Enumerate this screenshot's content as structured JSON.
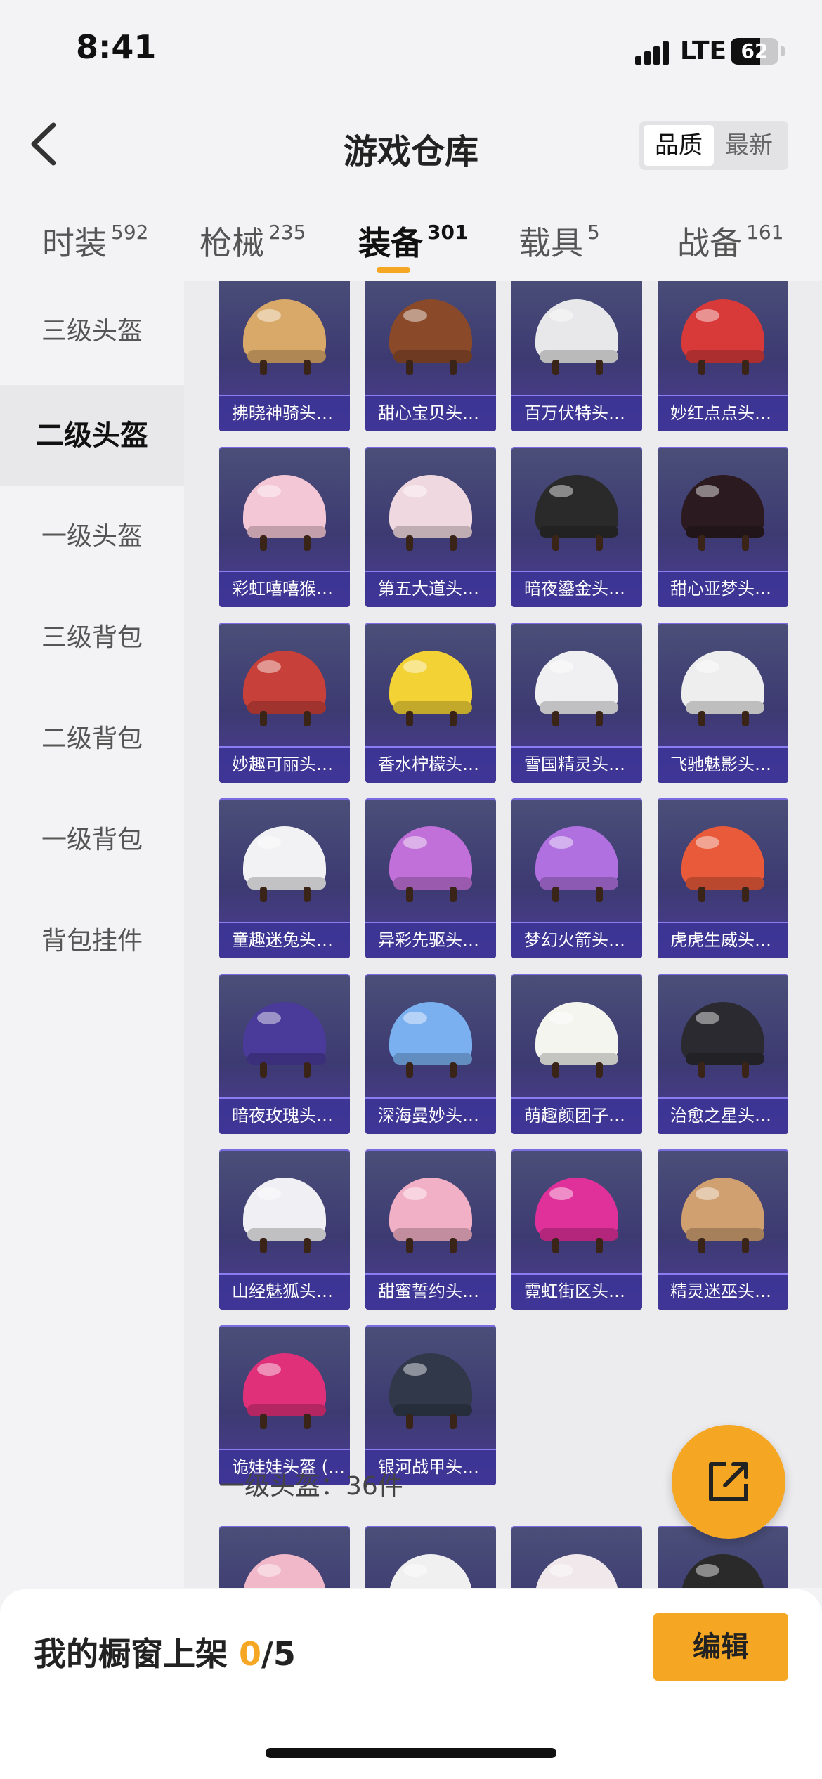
{
  "status": {
    "time": "8:41",
    "network": "LTE",
    "battery": "62",
    "battery_level": 0.62
  },
  "header": {
    "title": "游戏仓库",
    "sort_options": [
      "品质",
      "最新"
    ],
    "active_sort": "品质"
  },
  "tabs": [
    {
      "label": "时装",
      "count": "592"
    },
    {
      "label": "枪械",
      "count": "235"
    },
    {
      "label": "装备",
      "count": "301"
    },
    {
      "label": "载具",
      "count": "5"
    },
    {
      "label": "战备",
      "count": "161"
    }
  ],
  "sidebar": {
    "items": [
      "三级头盔",
      "二级头盔",
      "一级头盔",
      "三级背包",
      "二级背包",
      "一级背包",
      "背包挂件"
    ],
    "active": "二级头盔"
  },
  "items": [
    {
      "name": "拂晓神骑头…",
      "color": "#d9a96a"
    },
    {
      "name": "甜心宝贝头…",
      "color": "#8a4a2a"
    },
    {
      "name": "百万伏特头…",
      "color": "#e8e8ea"
    },
    {
      "name": "妙红点点头…",
      "color": "#d83a3a"
    },
    {
      "name": "彩虹嘻嘻猴…",
      "color": "#f4c7d6"
    },
    {
      "name": "第五大道头…",
      "color": "#f0d8e0"
    },
    {
      "name": "暗夜鎏金头…",
      "color": "#2a2a2a"
    },
    {
      "name": "甜心亚梦头…",
      "color": "#2b1a20"
    },
    {
      "name": "妙趣可丽头…",
      "color": "#c8403a"
    },
    {
      "name": "香水柠檬头…",
      "color": "#f3d236"
    },
    {
      "name": "雪国精灵头…",
      "color": "#f0f0f2"
    },
    {
      "name": "飞驰魅影头…",
      "color": "#eeeeee"
    },
    {
      "name": "童趣迷兔头…",
      "color": "#f2f2f5"
    },
    {
      "name": "异彩先驱头…",
      "color": "#c070d8"
    },
    {
      "name": "梦幻火箭头…",
      "color": "#b070e0"
    },
    {
      "name": "虎虎生威头…",
      "color": "#e85a3a"
    },
    {
      "name": "暗夜玫瑰头…",
      "color": "#4a3a9a"
    },
    {
      "name": "深海曼妙头…",
      "color": "#7ab0f0"
    },
    {
      "name": "萌趣颜团子…",
      "color": "#f5f5f0"
    },
    {
      "name": "治愈之星头…",
      "color": "#2a2a30"
    },
    {
      "name": "山经魅狐头…",
      "color": "#f0f0f4"
    },
    {
      "name": "甜蜜誓约头…",
      "color": "#f2b0c6"
    },
    {
      "name": "霓虹街区头…",
      "color": "#e0309a"
    },
    {
      "name": "精灵迷巫头…",
      "color": "#d0a070"
    },
    {
      "name": "诡娃娃头盔 (…",
      "color": "#e0307a"
    },
    {
      "name": "银河战甲头…",
      "color": "#30384a"
    }
  ],
  "section": {
    "label": "一级头盔：36件"
  },
  "next_items_colors": [
    "#f0b8c8",
    "#f0f0f0",
    "#f0e8ea",
    "#2a2a2a"
  ],
  "bottom": {
    "shelf_label": "我的橱窗上架",
    "shelf_count": "0",
    "shelf_total": "/5",
    "edit_label": "编辑"
  }
}
